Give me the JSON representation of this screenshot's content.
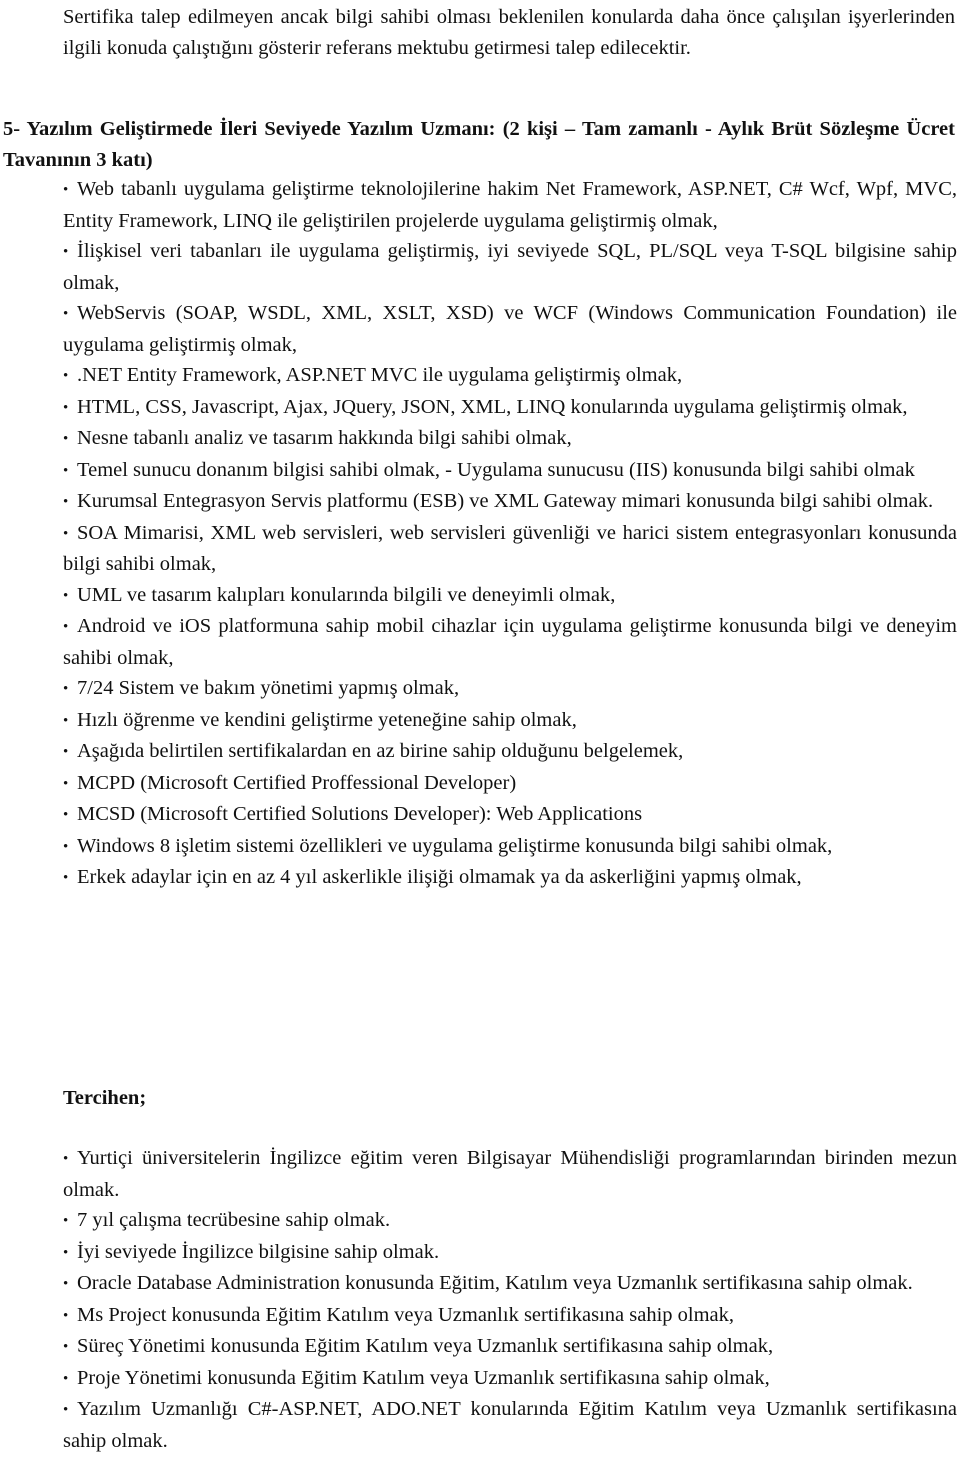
{
  "intro_paragraph": "Sertifika talep edilmeyen ancak bilgi sahibi olması beklenilen konularda daha önce çalışılan işyerlerinden ilgili konuda çalıştığını gösterir referans mektubu getirmesi talep edilecektir.",
  "section_heading": "5- Yazılım Geliştirmede İleri Seviyede Yazılım Uzmanı: (2 kişi – Tam zamanlı - Aylık Brüt Sözleşme Ücret Tavanının 3 katı)",
  "bullet_glyph": "•",
  "requirements": [
    "Web tabanlı uygulama geliştirme teknolojilerine hakim Net Framework, ASP.NET, C# Wcf, Wpf, MVC, Entity Framework, LINQ ile geliştirilen projelerde uygulama geliştirmiş olmak,",
    "İlişkisel veri tabanları ile uygulama geliştirmiş, iyi seviyede SQL, PL/SQL veya T-SQL bilgisine sahip olmak,",
    "WebServis (SOAP, WSDL, XML, XSLT, XSD) ve WCF (Windows Communication Foundation) ile uygulama geliştirmiş olmak,",
    ".NET Entity Framework, ASP.NET MVC ile uygulama geliştirmiş olmak,",
    "HTML, CSS, Javascript, Ajax, JQuery, JSON, XML, LINQ konularında uygulama geliştirmiş olmak,",
    "Nesne tabanlı analiz ve tasarım hakkında bilgi sahibi olmak,",
    "Temel sunucu donanım bilgisi sahibi olmak, - Uygulama sunucusu (IIS) konusunda bilgi sahibi olmak",
    "Kurumsal Entegrasyon Servis platformu (ESB) ve XML Gateway mimari konusunda bilgi sahibi olmak.",
    "SOA Mimarisi, XML web servisleri, web servisleri güvenliği ve harici sistem entegrasyonları konusunda bilgi sahibi olmak,",
    "UML ve tasarım kalıpları konularında bilgili ve deneyimli olmak,",
    "Android ve iOS platformuna sahip mobil cihazlar için uygulama geliştirme konusunda bilgi ve deneyim sahibi olmak,",
    "7/24 Sistem ve bakım yönetimi yapmış olmak,",
    "Hızlı öğrenme ve kendini geliştirme yeteneğine sahip olmak,",
    "Aşağıda belirtilen sertifikalardan en az birine sahip olduğunu belgelemek,",
    "MCPD (Microsoft Certified Proffessional Developer)",
    "MCSD (Microsoft Certified Solutions Developer): Web Applications",
    "Windows 8 işletim sistemi özellikleri ve uygulama geliştirme konusunda bilgi sahibi olmak,",
    "Erkek adaylar için en az 4 yıl askerlikle ilişiği olmamak ya da askerliğini yapmış olmak,"
  ],
  "preferred_heading": "Tercihen;",
  "preferred": [
    "Yurtiçi üniversitelerin İngilizce eğitim veren Bilgisayar Mühendisliği programlarından birinden mezun olmak.",
    "7 yıl çalışma tecrübesine sahip olmak.",
    "İyi seviyede İngilizce bilgisine sahip olmak.",
    "Oracle Database Administration konusunda Eğitim, Katılım veya Uzmanlık sertifikasına sahip olmak.",
    "Ms Project konusunda Eğitim Katılım veya Uzmanlık sertifikasına sahip olmak,",
    "Süreç Yönetimi konusunda Eğitim Katılım veya Uzmanlık sertifikasına sahip olmak,",
    "Proje Yönetimi konusunda Eğitim Katılım veya Uzmanlık sertifikasına sahip olmak,",
    "Yazılım Uzmanlığı C#-ASP.NET, ADO.NET konularında Eğitim Katılım veya Uzmanlık sertifikasına sahip olmak."
  ]
}
